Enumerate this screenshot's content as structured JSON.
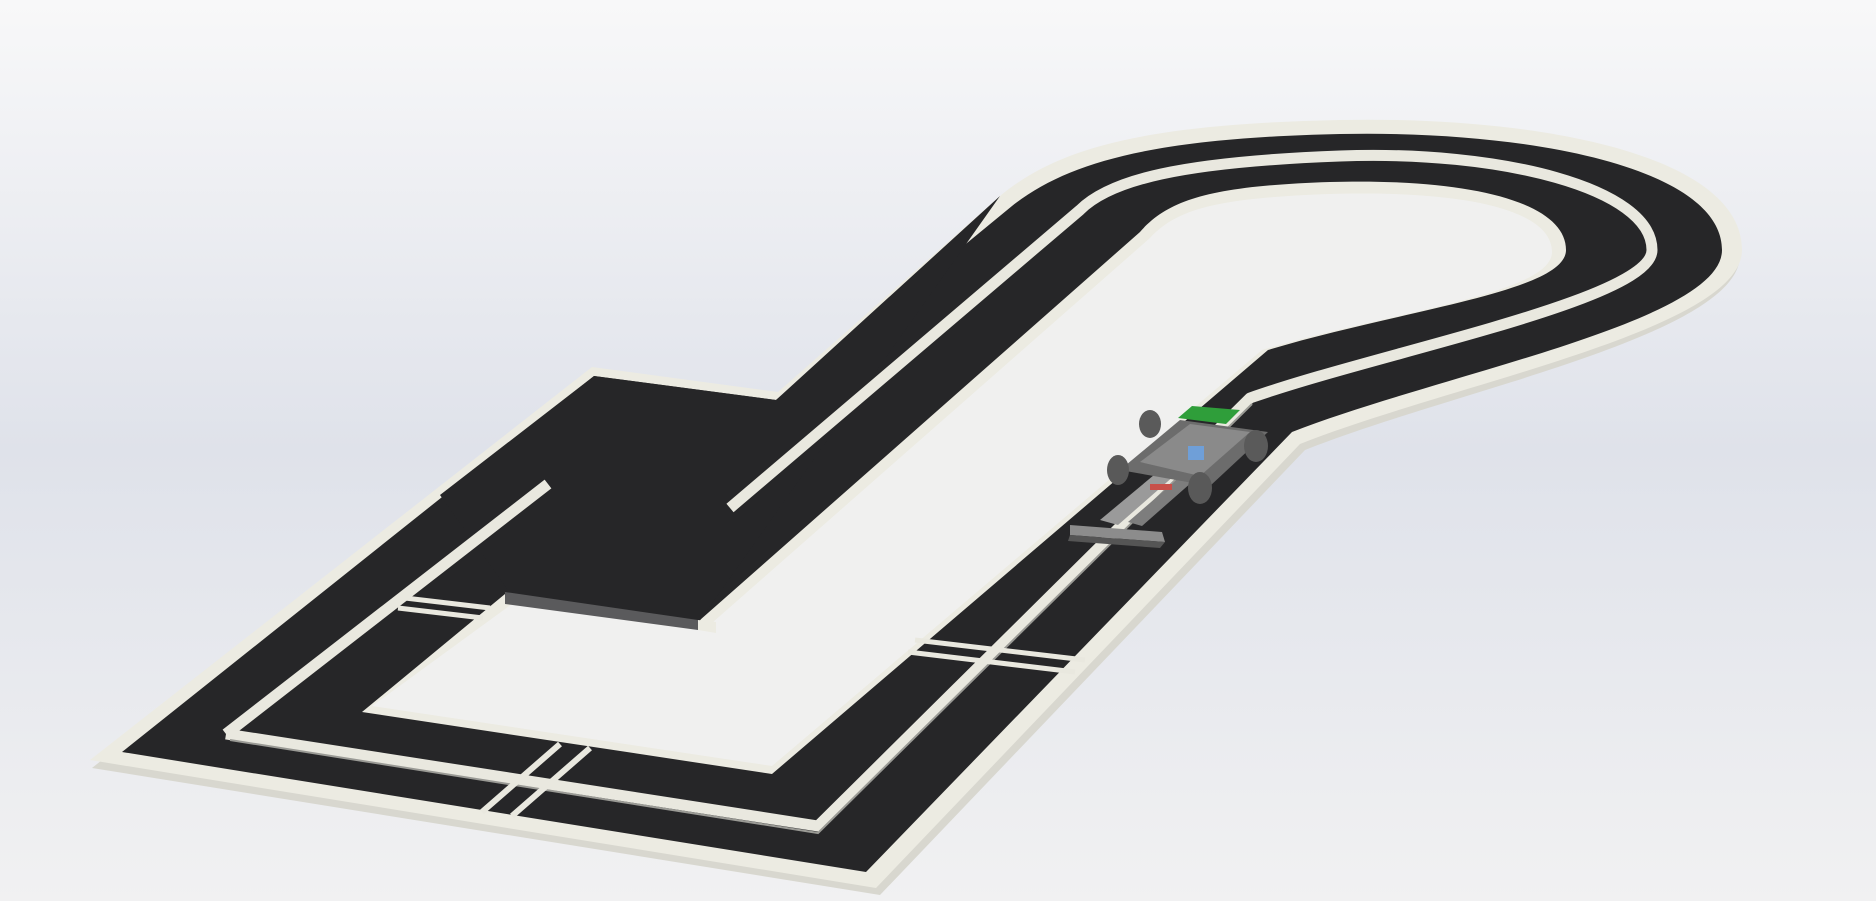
{
  "scene": {
    "description_visible_text": "",
    "colors": {
      "background_top": "#f7f7f8",
      "background_mid": "#dde1e9",
      "background_bottom": "#f2f2f3",
      "track_surface": "#262628",
      "track_border": "#ecebe2",
      "track_border_shadow": "#bdbdb6",
      "lane_line": "#e9e8df",
      "robot_body": "#6c6c6c",
      "robot_dark": "#3b3b3b",
      "robot_board": "#2f9e3a",
      "robot_accent_blue": "#6f9fd8",
      "robot_accent_red": "#c8504a"
    }
  }
}
